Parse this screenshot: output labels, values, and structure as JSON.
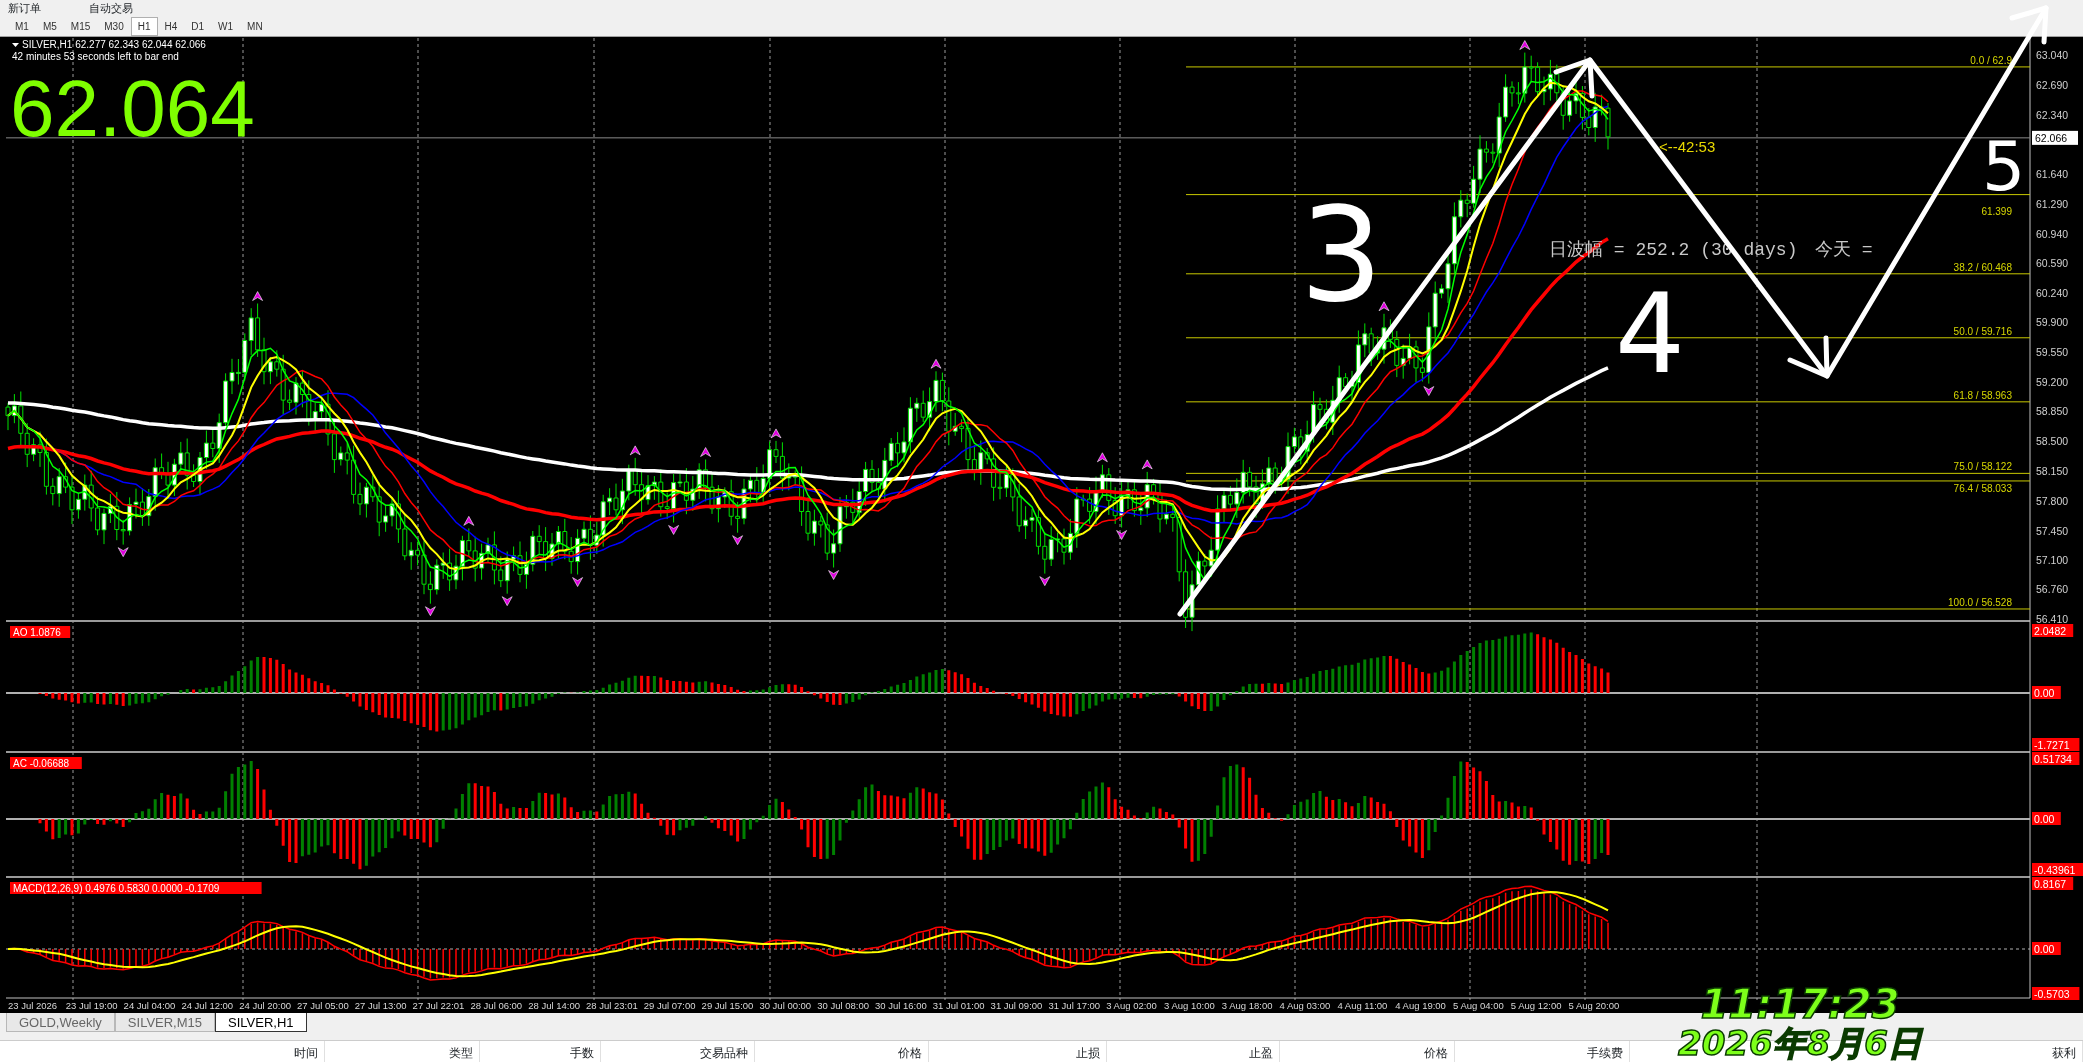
{
  "toolbar": {
    "items": [
      "新订单",
      "自动交易"
    ]
  },
  "timeframes": [
    {
      "label": "M1",
      "selected": false
    },
    {
      "label": "M5",
      "selected": false
    },
    {
      "label": "M15",
      "selected": false
    },
    {
      "label": "M30",
      "selected": false
    },
    {
      "label": "H1",
      "selected": true
    },
    {
      "label": "H4",
      "selected": false
    },
    {
      "label": "D1",
      "selected": false
    },
    {
      "label": "W1",
      "selected": false
    },
    {
      "label": "MN",
      "selected": false
    }
  ],
  "chart": {
    "symbol_info": "SILVER,H1  62.277 62.343 62.044 62.066",
    "countdown": "42 minutes 53 seconds left to bar end",
    "big_price": "62.064",
    "bar_timer": "<--42:53",
    "current_price": "62.066",
    "price_axis": [
      "63.040",
      "62.690",
      "62.340",
      "61.640",
      "61.290",
      "60.940",
      "60.590",
      "60.240",
      "59.900",
      "59.550",
      "59.200",
      "58.850",
      "58.500",
      "58.150",
      "57.800",
      "57.450",
      "57.100",
      "56.760",
      "56.410"
    ],
    "fib_levels": [
      {
        "ratio_label": "0.0 /",
        "price": "62.9"
      },
      {
        "price": "61.399"
      },
      {
        "ratio_label": "38.2 /",
        "price": "60.468"
      },
      {
        "ratio_label": "50.0 /",
        "price": "59.716"
      },
      {
        "ratio_label": "61.8 /",
        "price": "58.963"
      },
      {
        "ratio_label": "75.0 /",
        "price": "58.122"
      },
      {
        "ratio_label": "76.4 /",
        "price": "58.033"
      },
      {
        "ratio_label": "100.0 /",
        "price": "56.528"
      }
    ],
    "range_text": "日波幅 = 252.2 (30 days)",
    "today_text": "今天 =",
    "wave_labels": [
      "3",
      "4",
      "5"
    ]
  },
  "indicators": [
    {
      "kind": "ao",
      "label": "AO 1.0876",
      "axis": [
        "2.0482",
        "0.00",
        "-1.7271"
      ]
    },
    {
      "kind": "ac",
      "label": "AC -0.06688",
      "axis": [
        "0.51734",
        "0.00",
        "-0.43961"
      ]
    },
    {
      "kind": "macd",
      "label": "MACD(12,26,9) 0.4976 0.5830 0.0000 -0.1709",
      "axis": [
        "0.8167",
        "0.00",
        "-0.5703"
      ]
    }
  ],
  "time_axis": [
    "23 Jul 2026",
    "23 Jul 19:00",
    "24 Jul 04:00",
    "24 Jul 12:00",
    "24 Jul 20:00",
    "27 Jul 05:00",
    "27 Jul 13:00",
    "27 Jul 22:01",
    "28 Jul 06:00",
    "28 Jul 14:00",
    "28 Jul 23:01",
    "29 Jul 07:00",
    "29 Jul 15:00",
    "30 Jul 00:00",
    "30 Jul 08:00",
    "30 Jul 16:00",
    "31 Jul 01:00",
    "31 Jul 09:00",
    "31 Jul 17:00",
    "3 Aug 02:00",
    "3 Aug 10:00",
    "3 Aug 18:00",
    "4 Aug 03:00",
    "4 Aug 11:00",
    "4 Aug 19:00",
    "5 Aug 04:00",
    "5 Aug 12:00",
    "5 Aug 20:00"
  ],
  "chart_tabs": [
    {
      "label": "GOLD,Weekly",
      "selected": false
    },
    {
      "label": "SILVER,M15",
      "selected": false
    },
    {
      "label": "SILVER,H1",
      "selected": true
    }
  ],
  "terminal": {
    "columns": [
      "时间",
      "类型",
      "手数",
      "交易品种",
      "价格",
      "止损",
      "止盈",
      "价格",
      "手续费",
      "获利"
    ]
  },
  "clock": {
    "time": "11:17:23",
    "date": "2026年8月6日"
  }
}
